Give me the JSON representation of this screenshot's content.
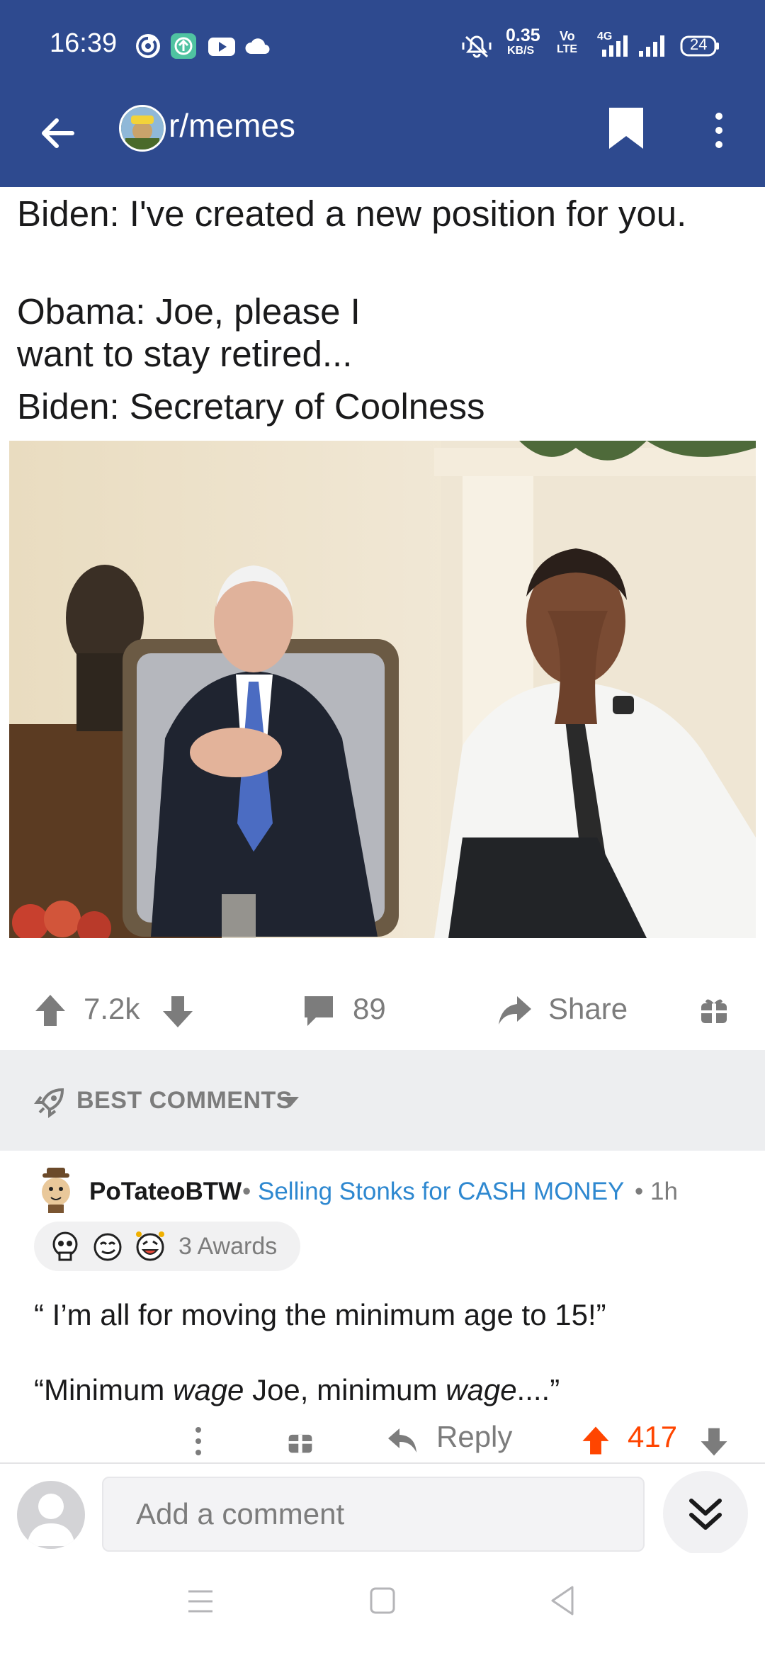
{
  "status_bar": {
    "time": "16:39",
    "network_speed": "0.35",
    "network_speed_unit": "KB/S",
    "volte_top": "Vo",
    "volte_bottom": "LTE",
    "network_type": "4G",
    "battery": "24",
    "left_icons": [
      "swirl-app-icon",
      "upload-app-icon",
      "youtube-icon",
      "cloud-icon"
    ],
    "right_icons": [
      "vibrate-icon",
      "signal-icon",
      "signal-icon",
      "battery-icon"
    ]
  },
  "header": {
    "subreddit": "r/memes",
    "icons": [
      "back-arrow-icon",
      "bookmark-icon",
      "more-vertical-icon"
    ]
  },
  "post": {
    "line1": "Biden: I've created a new position for you.",
    "line2": "Obama: Joe, please I\nwant to stay retired...",
    "line3": "Biden: Secretary of Coolness",
    "image_alt": "photo-of-biden-and-obama-seated"
  },
  "actions": {
    "score": "7.2k",
    "comments": "89",
    "share": "Share",
    "icons": [
      "upvote-icon",
      "downvote-icon",
      "comment-icon",
      "share-icon",
      "gift-icon"
    ]
  },
  "comments_header": {
    "sort_label": "BEST COMMENTS"
  },
  "comment": {
    "author": "PoTateoBTW",
    "separator": "•",
    "flair": "Selling Stonks for CASH MONEY",
    "time": "1h",
    "awards_label": "3 Awards",
    "body_line1": "“ I’m all for moving the minimum age to 15!”",
    "body_line2_parts": [
      "“Minimum ",
      "wage",
      " Joe, minimum ",
      "wage",
      "....”"
    ],
    "reply_label": "Reply",
    "score": "417",
    "score_color": "#ff4500"
  },
  "add_comment": {
    "placeholder": "Add a comment"
  },
  "colors": {
    "header_bg": "#2e4a8f",
    "flair_blue": "#2e88d0",
    "upvote_orange": "#ff4500",
    "muted_gray": "#7c7c7c"
  }
}
